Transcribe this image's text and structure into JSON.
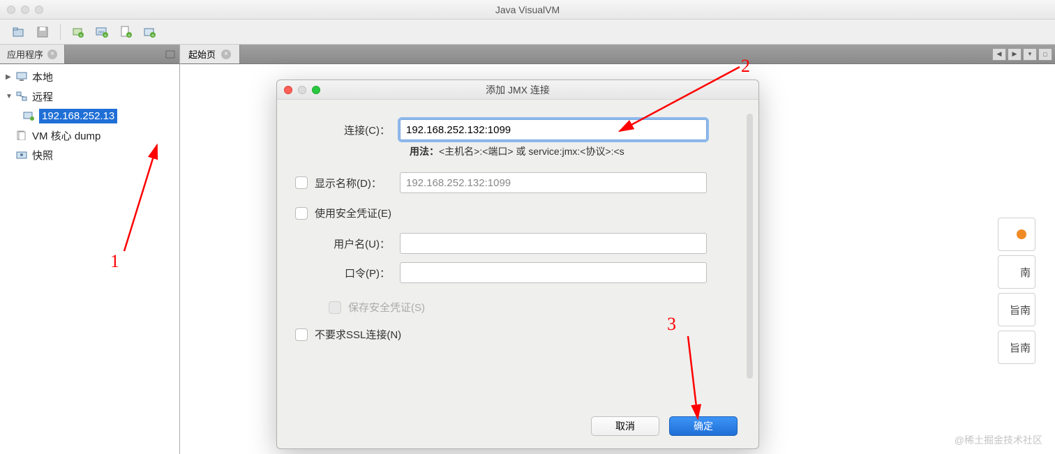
{
  "window": {
    "title": "Java VisualVM"
  },
  "sidebar": {
    "tab": "应用程序",
    "tree": {
      "local": "本地",
      "remote": "远程",
      "remote_host": "192.168.252.13",
      "vm_dump": "VM 核心 dump",
      "snapshot": "快照"
    }
  },
  "main": {
    "tab": "起始页"
  },
  "hints": {
    "card2": "南",
    "card3": "旨南",
    "card4": "旨南"
  },
  "dialog": {
    "title": "添加 JMX 连接",
    "connection_label": "连接(C)：",
    "connection_value": "192.168.252.132:1099",
    "usage_bold": "用法：",
    "usage_text": "<主机名>:<端口> 或 service:jmx:<协议>:<s",
    "display_name_label": "显示名称(D)：",
    "display_name_value": "192.168.252.132:1099",
    "use_credentials": "使用安全凭证(E)",
    "username_label": "用户名(U)：",
    "password_label": "口令(P)：",
    "save_credentials": "保存安全凭证(S)",
    "no_ssl": "不要求SSL连接(N)",
    "cancel": "取消",
    "ok": "确定"
  },
  "annotations": {
    "n1": "1",
    "n2": "2",
    "n3": "3"
  },
  "watermark": "@稀土掘金技术社区"
}
